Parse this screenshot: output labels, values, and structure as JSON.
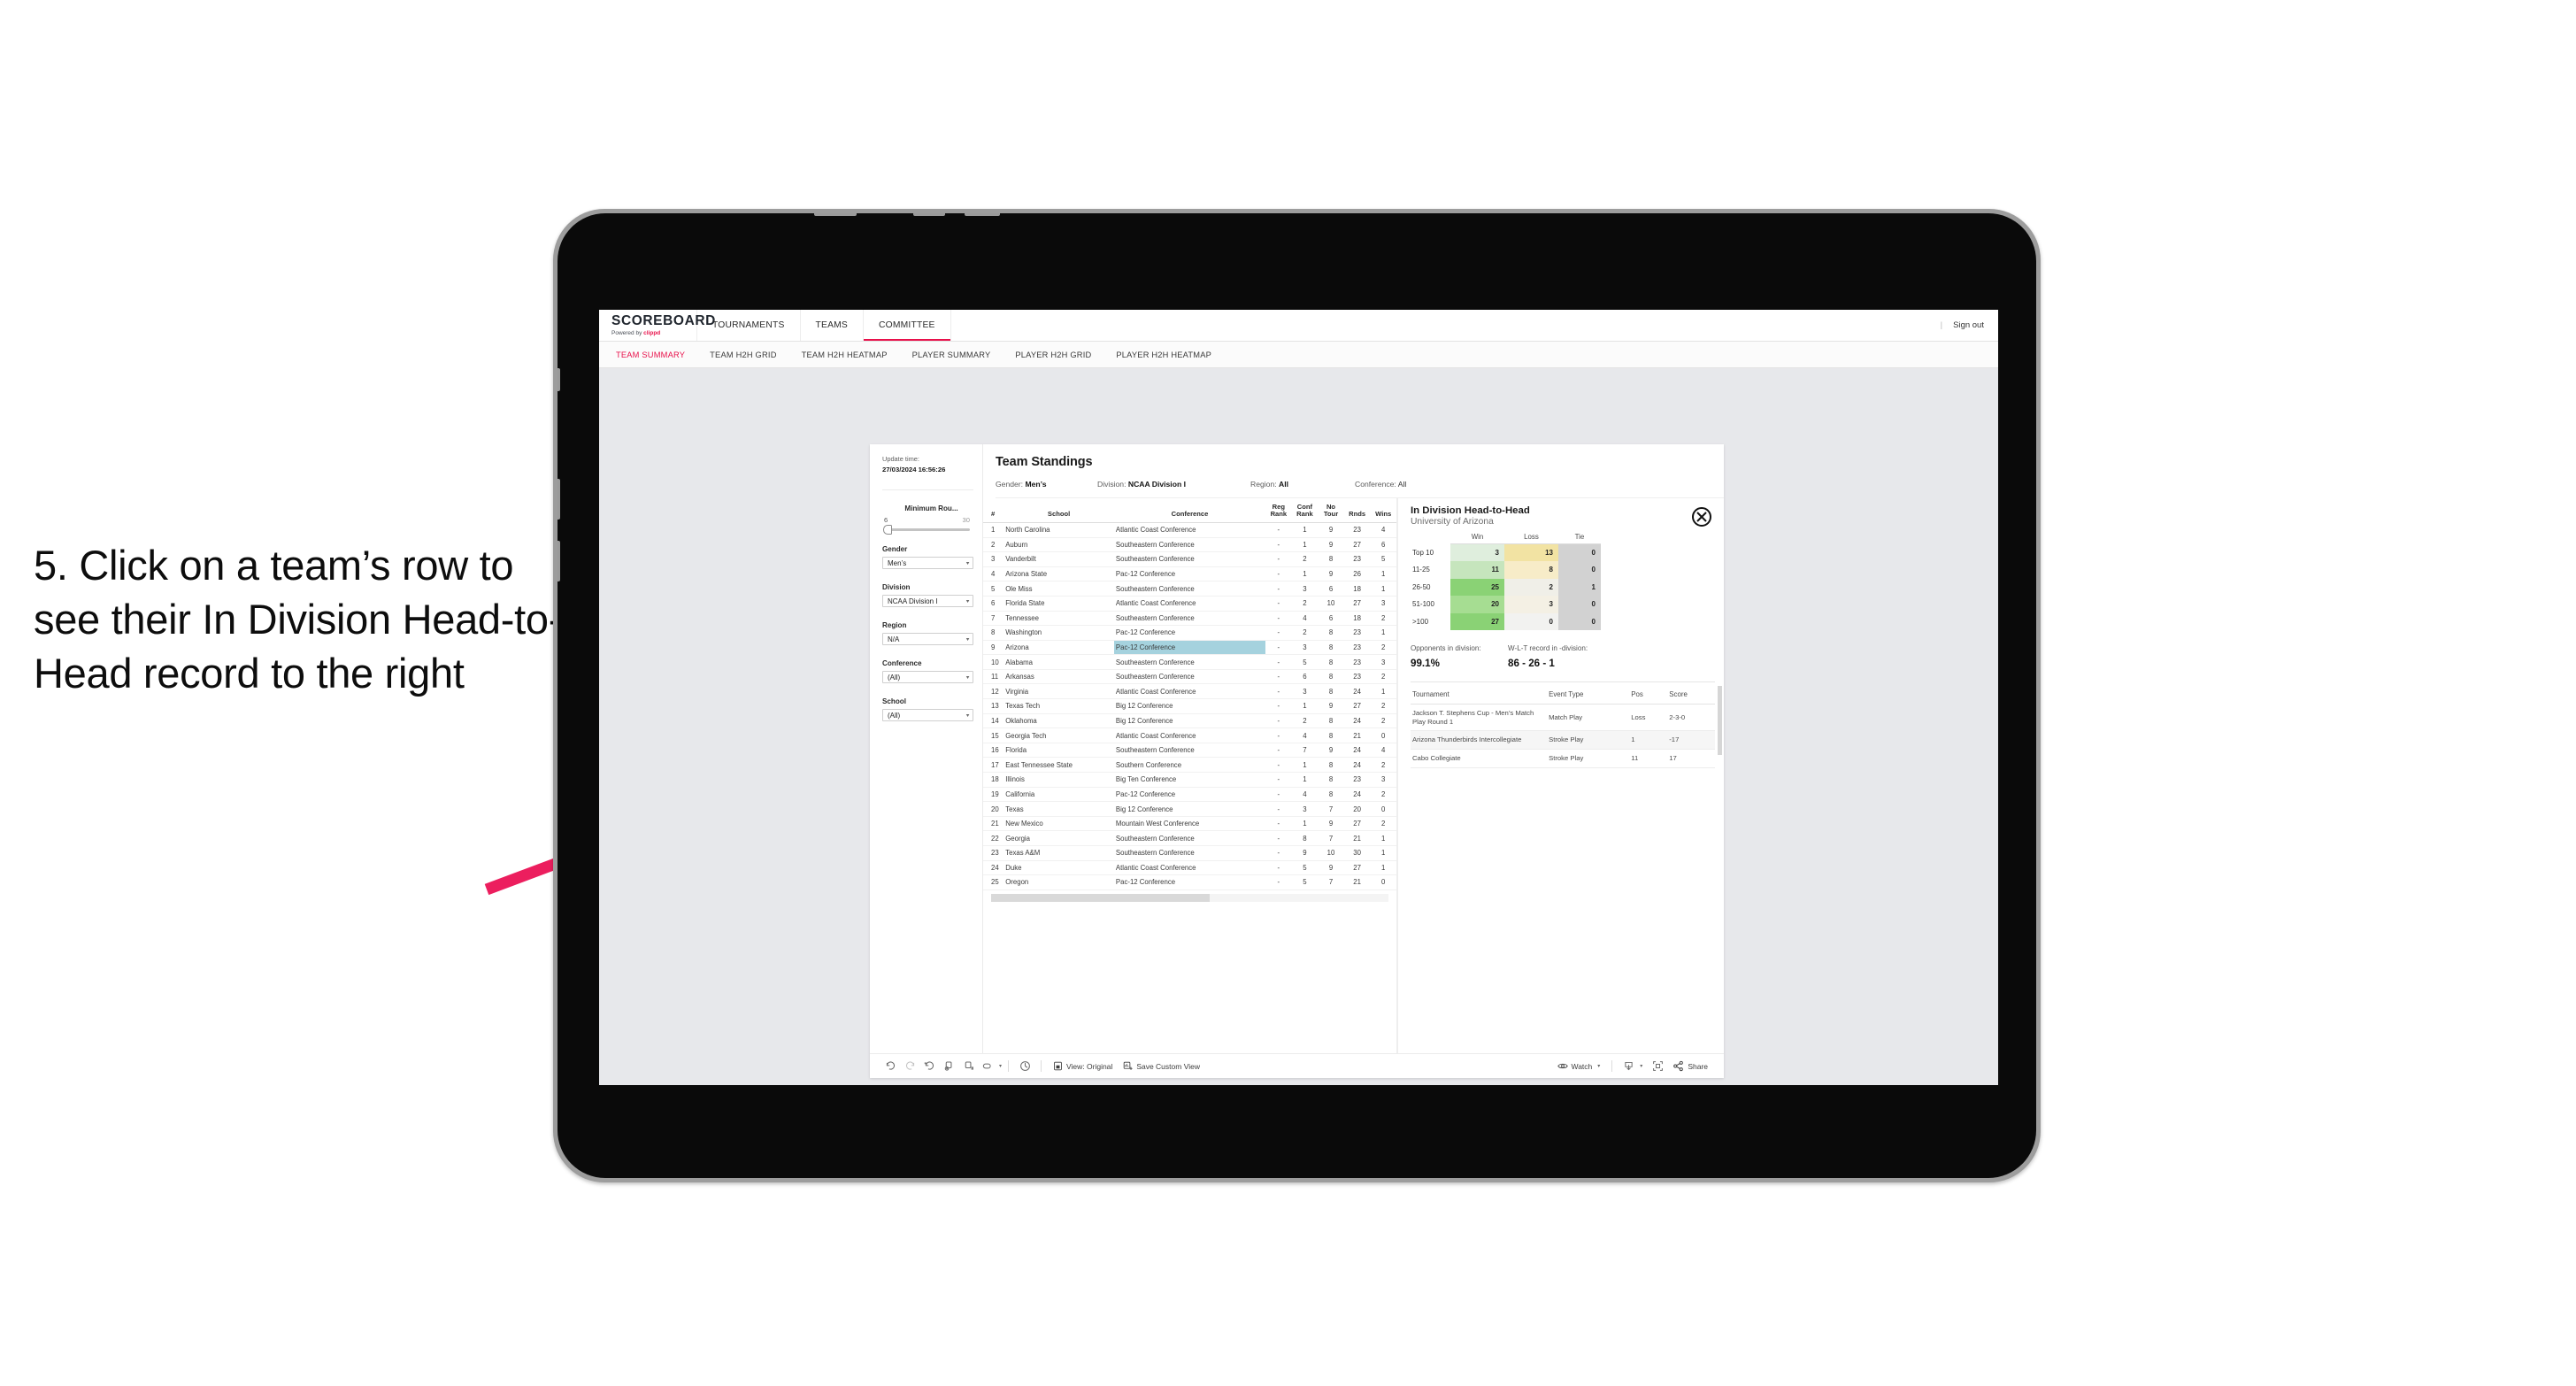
{
  "annotation": {
    "text": "5. Click on a team’s row to see their In Division Head-to-Head record to the right",
    "arrow_color": "#ec1e5e"
  },
  "app": {
    "brand": {
      "title": "SCOREBOARD",
      "powered_prefix": "Powered by ",
      "powered_name": "clippd"
    },
    "top_nav": [
      {
        "label": "TOURNAMENTS",
        "active": false
      },
      {
        "label": "TEAMS",
        "active": false
      },
      {
        "label": "COMMITTEE",
        "active": true
      }
    ],
    "sign_out": "Sign out",
    "sub_nav": [
      {
        "label": "TEAM SUMMARY",
        "active": true
      },
      {
        "label": "TEAM H2H GRID",
        "active": false
      },
      {
        "label": "TEAM H2H HEATMAP",
        "active": false
      },
      {
        "label": "PLAYER SUMMARY",
        "active": false
      },
      {
        "label": "PLAYER H2H GRID",
        "active": false
      },
      {
        "label": "PLAYER H2H HEATMAP",
        "active": false
      }
    ]
  },
  "rail": {
    "update_label": "Update time:",
    "update_value": "27/03/2024 16:56:26",
    "min_rounds": {
      "label": "Minimum Rou...",
      "min": "6",
      "max": "30",
      "value_pct": 4
    },
    "filters": [
      {
        "label": "Gender",
        "value": "Men’s"
      },
      {
        "label": "Division",
        "value": "NCAA Division I"
      },
      {
        "label": "Region",
        "value": "N/A"
      },
      {
        "label": "Conference",
        "value": "(All)"
      },
      {
        "label": "School",
        "value": "(All)"
      }
    ]
  },
  "viz": {
    "title": "Team Standings",
    "filters": [
      {
        "key": "Gender: ",
        "value": "Men’s",
        "strong": true
      },
      {
        "key": "Division: ",
        "value": "NCAA Division I",
        "strong": true
      },
      {
        "key": "Region: ",
        "value": "All",
        "strong": true
      },
      {
        "key": "Conference: ",
        "value": "All",
        "strong": false
      }
    ]
  },
  "standings": {
    "columns": [
      "#",
      "School",
      "Conference",
      "Reg Rank",
      "Conf Rank",
      "No Tour",
      "Rnds",
      "Wins"
    ],
    "column_lines": [
      [
        "#",
        ""
      ],
      [
        "School",
        ""
      ],
      [
        "Conference",
        ""
      ],
      [
        "Reg",
        "Rank"
      ],
      [
        "Conf",
        "Rank"
      ],
      [
        "No",
        "Tour"
      ],
      [
        "",
        "Rnds"
      ],
      [
        "",
        "Wins"
      ]
    ],
    "selected_row_index": 8,
    "rows": [
      {
        "rank": "1",
        "school": "North Carolina",
        "conference": "Atlantic Coast Conference",
        "reg": "-",
        "conf_rank": "1",
        "no_tour": "9",
        "rnds": "23",
        "wins": "4"
      },
      {
        "rank": "2",
        "school": "Auburn",
        "conference": "Southeastern Conference",
        "reg": "-",
        "conf_rank": "1",
        "no_tour": "9",
        "rnds": "27",
        "wins": "6"
      },
      {
        "rank": "3",
        "school": "Vanderbilt",
        "conference": "Southeastern Conference",
        "reg": "-",
        "conf_rank": "2",
        "no_tour": "8",
        "rnds": "23",
        "wins": "5"
      },
      {
        "rank": "4",
        "school": "Arizona State",
        "conference": "Pac-12 Conference",
        "reg": "-",
        "conf_rank": "1",
        "no_tour": "9",
        "rnds": "26",
        "wins": "1"
      },
      {
        "rank": "5",
        "school": "Ole Miss",
        "conference": "Southeastern Conference",
        "reg": "-",
        "conf_rank": "3",
        "no_tour": "6",
        "rnds": "18",
        "wins": "1"
      },
      {
        "rank": "6",
        "school": "Florida State",
        "conference": "Atlantic Coast Conference",
        "reg": "-",
        "conf_rank": "2",
        "no_tour": "10",
        "rnds": "27",
        "wins": "3"
      },
      {
        "rank": "7",
        "school": "Tennessee",
        "conference": "Southeastern Conference",
        "reg": "-",
        "conf_rank": "4",
        "no_tour": "6",
        "rnds": "18",
        "wins": "2"
      },
      {
        "rank": "8",
        "school": "Washington",
        "conference": "Pac-12 Conference",
        "reg": "-",
        "conf_rank": "2",
        "no_tour": "8",
        "rnds": "23",
        "wins": "1"
      },
      {
        "rank": "9",
        "school": "Arizona",
        "conference": "Pac-12 Conference",
        "reg": "-",
        "conf_rank": "3",
        "no_tour": "8",
        "rnds": "23",
        "wins": "2"
      },
      {
        "rank": "10",
        "school": "Alabama",
        "conference": "Southeastern Conference",
        "reg": "-",
        "conf_rank": "5",
        "no_tour": "8",
        "rnds": "23",
        "wins": "3"
      },
      {
        "rank": "11",
        "school": "Arkansas",
        "conference": "Southeastern Conference",
        "reg": "-",
        "conf_rank": "6",
        "no_tour": "8",
        "rnds": "23",
        "wins": "2"
      },
      {
        "rank": "12",
        "school": "Virginia",
        "conference": "Atlantic Coast Conference",
        "reg": "-",
        "conf_rank": "3",
        "no_tour": "8",
        "rnds": "24",
        "wins": "1"
      },
      {
        "rank": "13",
        "school": "Texas Tech",
        "conference": "Big 12 Conference",
        "reg": "-",
        "conf_rank": "1",
        "no_tour": "9",
        "rnds": "27",
        "wins": "2"
      },
      {
        "rank": "14",
        "school": "Oklahoma",
        "conference": "Big 12 Conference",
        "reg": "-",
        "conf_rank": "2",
        "no_tour": "8",
        "rnds": "24",
        "wins": "2"
      },
      {
        "rank": "15",
        "school": "Georgia Tech",
        "conference": "Atlantic Coast Conference",
        "reg": "-",
        "conf_rank": "4",
        "no_tour": "8",
        "rnds": "21",
        "wins": "0"
      },
      {
        "rank": "16",
        "school": "Florida",
        "conference": "Southeastern Conference",
        "reg": "-",
        "conf_rank": "7",
        "no_tour": "9",
        "rnds": "24",
        "wins": "4"
      },
      {
        "rank": "17",
        "school": "East Tennessee State",
        "conference": "Southern Conference",
        "reg": "-",
        "conf_rank": "1",
        "no_tour": "8",
        "rnds": "24",
        "wins": "2"
      },
      {
        "rank": "18",
        "school": "Illinois",
        "conference": "Big Ten Conference",
        "reg": "-",
        "conf_rank": "1",
        "no_tour": "8",
        "rnds": "23",
        "wins": "3"
      },
      {
        "rank": "19",
        "school": "California",
        "conference": "Pac-12 Conference",
        "reg": "-",
        "conf_rank": "4",
        "no_tour": "8",
        "rnds": "24",
        "wins": "2"
      },
      {
        "rank": "20",
        "school": "Texas",
        "conference": "Big 12 Conference",
        "reg": "-",
        "conf_rank": "3",
        "no_tour": "7",
        "rnds": "20",
        "wins": "0"
      },
      {
        "rank": "21",
        "school": "New Mexico",
        "conference": "Mountain West Conference",
        "reg": "-",
        "conf_rank": "1",
        "no_tour": "9",
        "rnds": "27",
        "wins": "2"
      },
      {
        "rank": "22",
        "school": "Georgia",
        "conference": "Southeastern Conference",
        "reg": "-",
        "conf_rank": "8",
        "no_tour": "7",
        "rnds": "21",
        "wins": "1"
      },
      {
        "rank": "23",
        "school": "Texas A&M",
        "conference": "Southeastern Conference",
        "reg": "-",
        "conf_rank": "9",
        "no_tour": "10",
        "rnds": "30",
        "wins": "1"
      },
      {
        "rank": "24",
        "school": "Duke",
        "conference": "Atlantic Coast Conference",
        "reg": "-",
        "conf_rank": "5",
        "no_tour": "9",
        "rnds": "27",
        "wins": "1"
      },
      {
        "rank": "25",
        "school": "Oregon",
        "conference": "Pac-12 Conference",
        "reg": "-",
        "conf_rank": "5",
        "no_tour": "7",
        "rnds": "21",
        "wins": "0"
      }
    ]
  },
  "detail": {
    "title": "In Division Head-to-Head",
    "subtitle": "University of Arizona",
    "close_icon": "close-circle-icon",
    "h2h_headers": [
      "",
      "Win",
      "Loss",
      "Tie"
    ],
    "h2h_rows": [
      {
        "bucket": "Top 10",
        "win": "3",
        "loss": "13",
        "tie": "0",
        "win_color": "#dfeedd",
        "loss_color": "#f2e3a3",
        "tie_color": "#d2d2d2"
      },
      {
        "bucket": "11-25",
        "win": "11",
        "loss": "8",
        "tie": "0",
        "win_color": "#c6e5bd",
        "loss_color": "#f7ecc8",
        "tie_color": "#d2d2d2"
      },
      {
        "bucket": "26-50",
        "win": "25",
        "loss": "2",
        "tie": "1",
        "win_color": "#8ad275",
        "loss_color": "#f0efe8",
        "tie_color": "#d2d2d2"
      },
      {
        "bucket": "51-100",
        "win": "20",
        "loss": "3",
        "tie": "0",
        "win_color": "#a6dd92",
        "loss_color": "#f4f0e4",
        "tie_color": "#d2d2d2"
      },
      {
        "bucket": ">100",
        "win": "27",
        "loss": "0",
        "tie": "0",
        "win_color": "#8ad275",
        "loss_color": "#f2f2f0",
        "tie_color": "#d2d2d2"
      }
    ],
    "kpis": [
      {
        "label": "Opponents in division:",
        "value": "99.1%"
      },
      {
        "label": "W-L-T record in -division:",
        "value": "86 - 26 - 1"
      }
    ],
    "tour_headers": [
      "Tournament",
      "Event Type",
      "Pos",
      "Score"
    ],
    "tour_rows": [
      {
        "tournament": "Jackson T. Stephens Cup - Men’s Match Play Round 1",
        "event_type": "Match Play",
        "pos": "Loss",
        "score": "2-3-0"
      },
      {
        "tournament": "Arizona Thunderbirds Intercollegiate",
        "event_type": "Stroke Play",
        "pos": "1",
        "score": "-17"
      },
      {
        "tournament": "Cabo Collegiate",
        "event_type": "Stroke Play",
        "pos": "11",
        "score": "17"
      }
    ]
  },
  "toolbar": {
    "icons": [
      "undo-icon",
      "redo-icon",
      "revert-icon",
      "refresh-data-icon",
      "pause-updates-icon",
      "device-layout-icon"
    ],
    "help_icon": "help-circle-icon",
    "view_icon": "view-icon",
    "view_label": "View: Original",
    "save_icon": "save-custom-view-icon",
    "save_label": "Save Custom View",
    "watch_icon": "eye-icon",
    "watch_label": "Watch",
    "download_icon": "download-icon",
    "fullscreen_icon": "fullscreen-icon",
    "share_icon": "share-icon",
    "share_label": "Share"
  }
}
